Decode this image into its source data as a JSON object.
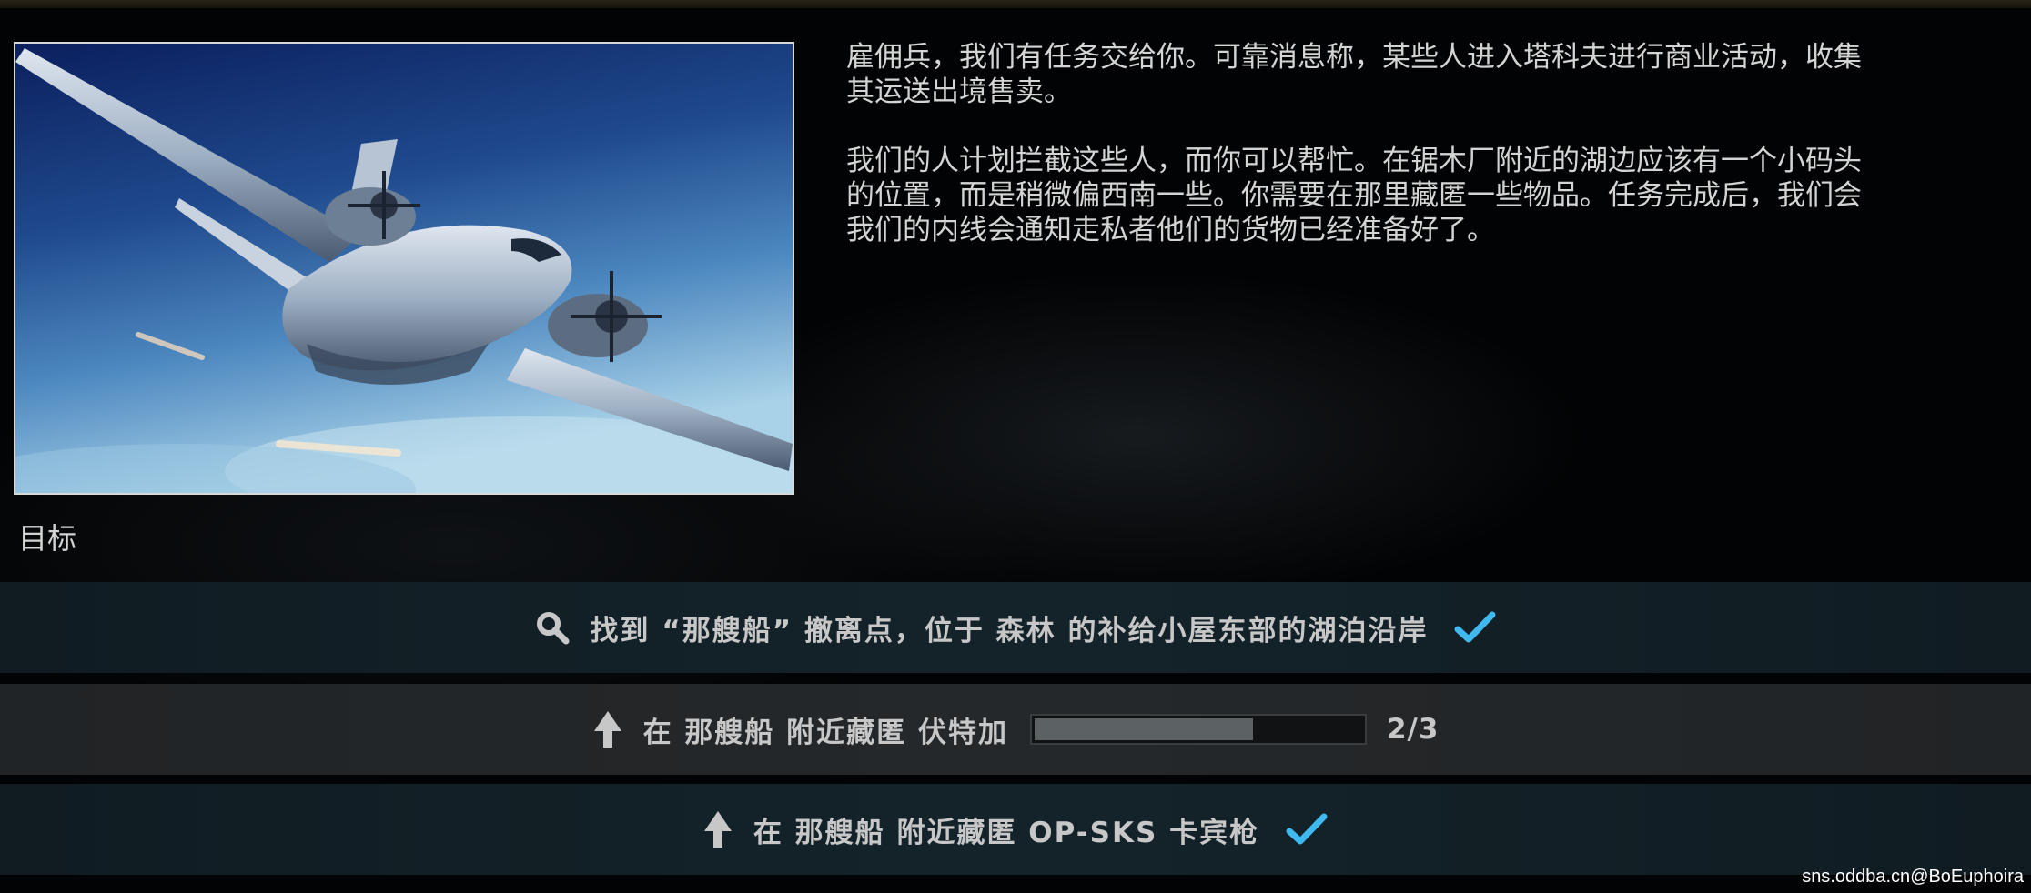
{
  "quest": {
    "image_alt": "transport aircraft in flight",
    "description": {
      "paragraph_1": [
        "雇佣兵，我们有任务交给你。可靠消息称，某些人进入塔科夫进行商业活动，收集",
        "其运送出境售卖。"
      ],
      "paragraph_2": [
        "我们的人计划拦截这些人，而你可以帮忙。在锯木厂附近的湖边应该有一个小码头",
        "的位置，而是稍微偏西南一些。你需要在那里藏匿一些物品。任务完成后，我们会",
        "我们的内线会通知走私者他们的货物已经准备好了。"
      ]
    }
  },
  "objectives": {
    "heading": "目标",
    "items": [
      {
        "icon": "magnifier-icon",
        "text": "找到 “那艘船” 撤离点，位于 森林 的补给小屋东部的湖泊沿岸",
        "completed": true
      },
      {
        "icon": "up-arrow-icon",
        "text": "在 那艘船 附近藏匿 伏特加",
        "completed": false,
        "progress": {
          "current": 2,
          "total": 3,
          "label": "2/3"
        }
      },
      {
        "icon": "up-arrow-icon",
        "text": "在 那艘船 附近藏匿 OP-SKS 卡宾枪",
        "completed": true
      }
    ]
  },
  "watermark": "sns.oddba.cn@BoEuphoira",
  "colors": {
    "check_accent": "#3fb9ee",
    "done_row_bg": "#14232a",
    "active_row_bg": "#25282a",
    "text": "#c7c7c7"
  }
}
